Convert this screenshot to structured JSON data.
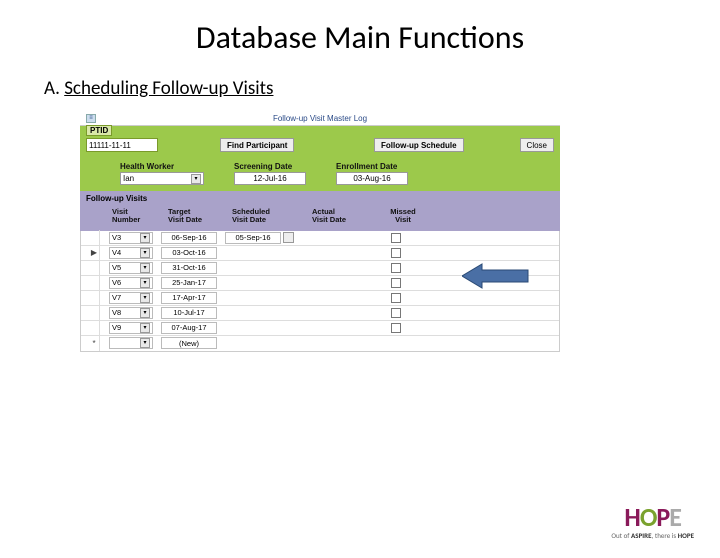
{
  "slide": {
    "title": "Database Main Functions",
    "subtitle_prefix": "A. ",
    "subtitle_link": "Scheduling Follow-up Visits"
  },
  "app": {
    "window_title": "Follow-up Visit Master Log",
    "ptid_label": "PTID",
    "ptid_value": "11111-11-11",
    "btn_find": "Find Participant",
    "btn_schedule": "Follow-up Schedule",
    "btn_close": "Close",
    "hw_label": "Health Worker",
    "hw_value": "Ian",
    "screen_label": "Screening Date",
    "screen_value": "12-Jul-16",
    "enroll_label": "Enrollment Date",
    "enroll_value": "03-Aug-16",
    "section_title": "Follow-up Visits",
    "columns": {
      "visit_number": "Visit\nNumber",
      "target": "Target\nVisit Date",
      "scheduled": "Scheduled\nVisit Date",
      "actual": "Actual\nVisit Date",
      "missed": "Missed\nVisit"
    },
    "rows": [
      {
        "marker": "",
        "vn": "V3",
        "target": "06-Sep-16",
        "scheduled": "05-Sep-16",
        "has_date_btn": true,
        "missed": false
      },
      {
        "marker": "▶",
        "vn": "V4",
        "target": "03-Oct-16",
        "scheduled": "",
        "has_date_btn": false,
        "missed": false
      },
      {
        "marker": "",
        "vn": "V5",
        "target": "31-Oct-16",
        "scheduled": "",
        "has_date_btn": false,
        "missed": false
      },
      {
        "marker": "",
        "vn": "V6",
        "target": "25-Jan-17",
        "scheduled": "",
        "has_date_btn": false,
        "missed": false
      },
      {
        "marker": "",
        "vn": "V7",
        "target": "17-Apr-17",
        "scheduled": "",
        "has_date_btn": false,
        "missed": false
      },
      {
        "marker": "",
        "vn": "V8",
        "target": "10-Jul-17",
        "scheduled": "",
        "has_date_btn": false,
        "missed": false
      },
      {
        "marker": "",
        "vn": "V9",
        "target": "07-Aug-17",
        "scheduled": "",
        "has_date_btn": false,
        "missed": false
      },
      {
        "marker": "*",
        "vn": "",
        "target": "(New)",
        "scheduled": "",
        "has_date_btn": false,
        "missed": null
      }
    ]
  },
  "logo": {
    "tagline_prefix": "Out of ",
    "tagline_mid": "ASPIRE",
    "tagline_suffix": ", there is ",
    "tagline_end": "HOPE"
  }
}
